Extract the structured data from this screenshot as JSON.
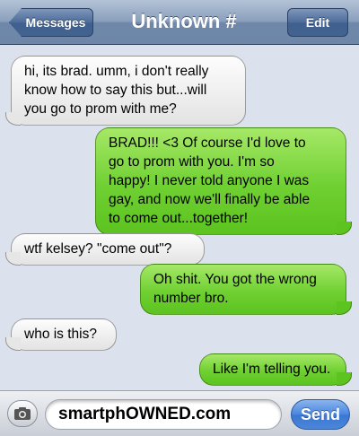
{
  "header": {
    "back_label": "Messages",
    "title": "Unknown #",
    "edit_label": "Edit"
  },
  "messages": [
    {
      "direction": "incoming",
      "lines": [
        "hi, its brad. umm, i don't really",
        "know how to say this but...will",
        "you go to prom with me?"
      ]
    },
    {
      "direction": "outgoing",
      "lines": [
        "BRAD!!! <3 Of course I'd love to",
        "go to prom with you. I'm so",
        "happy! I never told anyone I was",
        "gay, and now we'll finally be able",
        "to come out...together!"
      ]
    },
    {
      "direction": "incoming",
      "lines": [
        "wtf kelsey? \"come out\"?"
      ]
    },
    {
      "direction": "outgoing",
      "lines": [
        "Oh shit. You got the wrong",
        "number bro."
      ]
    },
    {
      "direction": "incoming",
      "lines": [
        "who is this?"
      ]
    },
    {
      "direction": "outgoing",
      "lines": [
        "Like I'm telling you."
      ]
    }
  ],
  "composer": {
    "input_text": "smartphOWNED.com",
    "send_label": "Send",
    "camera_icon": "camera-icon"
  },
  "colors": {
    "header_blue": "#6f88aa",
    "outgoing_green": "#6fd032",
    "incoming_gray": "#e3e3e3",
    "background": "#dbe2ed",
    "send_blue": "#4a86df"
  }
}
